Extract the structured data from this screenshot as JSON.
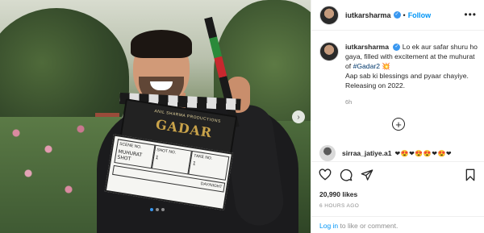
{
  "header": {
    "username": "iutkarsharma",
    "separator": "•",
    "follow_label": "Follow",
    "more_label": "•••",
    "verified_mark": "✓"
  },
  "caption": {
    "username": "iutkarsharma",
    "text": "Lo ek aur safar shuru ho gaya, filled with excitement at the muhurat of ",
    "hashtag": "#Gadar2",
    "emoji": "💥",
    "line2": "Aap sab ki blessings and pyaar chayiye. Releasing on 2022.",
    "time": "6h"
  },
  "load_more": "+",
  "comment": {
    "username": "sirraa_jatiye.a1",
    "text": "❤😍❤😍😍❤😍❤"
  },
  "icons": [
    "heart-icon",
    "comment-icon",
    "share-icon",
    "bookmark-icon"
  ],
  "likes": "20,990 likes",
  "posted_ago": "6 HOURS AGO",
  "footer": {
    "login_label": "Log in",
    "suffix": " to like or comment."
  },
  "clapper": {
    "production": "ANIL SHARMA PRODUCTIONS",
    "film_title": "GADAR",
    "scene_label": "SCENE NO.",
    "scene_value": "MUHURAT SHOT",
    "shot_label": "SHOT NO.",
    "shot_value": "1",
    "take_label": "TAKE NO.",
    "take_value": "1",
    "date_label": "DAY/NIGHT"
  },
  "carousel": {
    "next_label": "›",
    "count": 3,
    "active_index": 0
  },
  "colors": {
    "accent": "#0095f6",
    "verified": "#3897f0",
    "text": "#262626",
    "muted": "#8e8e8e"
  }
}
